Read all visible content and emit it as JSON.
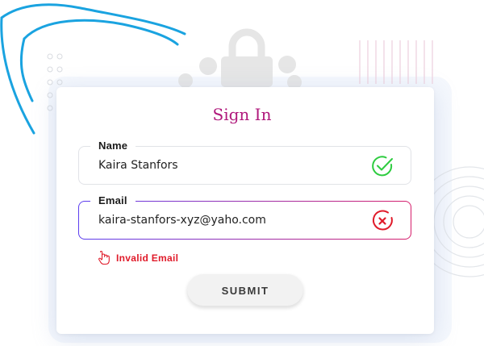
{
  "form": {
    "title": "Sign In",
    "name_field": {
      "label": "Name",
      "value": "Kaira Stanfors",
      "status": "valid"
    },
    "email_field": {
      "label": "Email",
      "value": "kaira-stanfors-xyz@yaho.com",
      "status": "invalid"
    },
    "error_message": "Invalid Email",
    "submit_label": "SUBMIT"
  },
  "colors": {
    "title": "#b0197c",
    "valid_icon": "#2ecc40",
    "invalid_icon": "#e01b2a",
    "error_text": "#e01b2a",
    "decor_curve": "#1aa3e0",
    "email_border_start": "#5b3df0",
    "email_border_end": "#d61f6c"
  },
  "icons": {
    "name_status": "check-circle-icon",
    "email_status": "x-circle-icon",
    "error": "hand-pointer-icon",
    "background": "padlock-icon"
  }
}
